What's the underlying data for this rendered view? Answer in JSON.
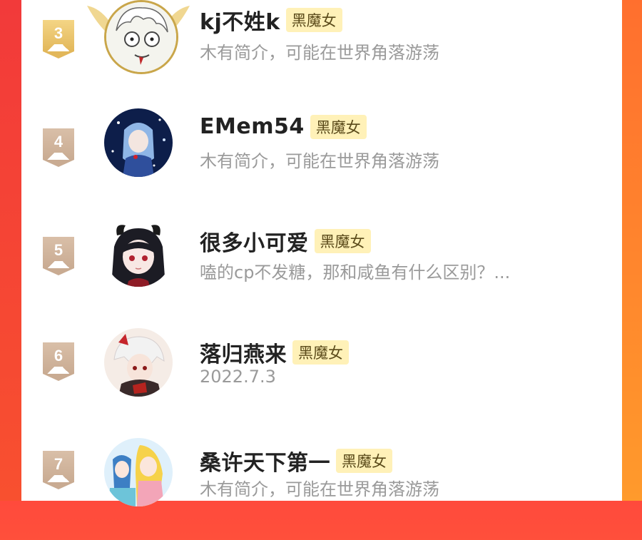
{
  "colors": {
    "accent_left": "#f23a3a",
    "accent_right": "#ff9a2c",
    "badge_bg": "#fff1b8",
    "rank_gold": "#e2b75a",
    "rank_plain": "#c9ab92",
    "desc_text": "#9a9a9a"
  },
  "ranking": [
    {
      "rank": "3",
      "name": "kj不姓k",
      "badge": "黑魔女",
      "desc": "木有简介，可能在世界角落游荡",
      "rank_style": "gold",
      "avatar": "cartoon-boy-avatar"
    },
    {
      "rank": "4",
      "name": "EMem54",
      "badge": "黑魔女",
      "desc": "木有简介，可能在世界角落游荡",
      "rank_style": "plain",
      "avatar": "night-sky-girl-avatar"
    },
    {
      "rank": "5",
      "name": "很多小可爱",
      "badge": "黑魔女",
      "desc": "嗑的cp不发糖，那和咸鱼有什么区别？...",
      "rank_style": "plain",
      "avatar": "horned-girl-avatar"
    },
    {
      "rank": "6",
      "name": "落归燕来",
      "badge": "黑魔女",
      "desc": "2022.7.3",
      "rank_style": "plain",
      "avatar": "white-hair-boy-avatar"
    },
    {
      "rank": "7",
      "name": "桑许天下第一",
      "badge": "黑魔女",
      "desc": "木有简介，可能在世界角落游荡",
      "rank_style": "plain",
      "avatar": "anime-group-avatar"
    }
  ]
}
